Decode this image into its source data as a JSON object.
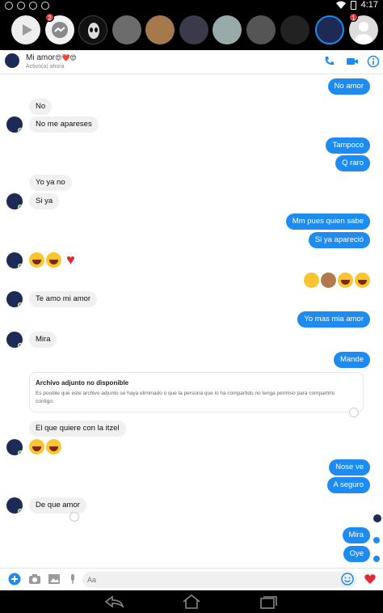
{
  "status_bar": {
    "time": "4:17"
  },
  "chat_heads": {
    "badge_messenger": "2",
    "badge_last": "1"
  },
  "header": {
    "name": "Mi amor",
    "name_emojis": "😍❤️😍",
    "status": "Activo(a) ahora"
  },
  "messages": [
    {
      "side": "out",
      "text": "No amor"
    },
    {
      "side": "in",
      "text": "No"
    },
    {
      "side": "in",
      "text": "No me apareses"
    },
    {
      "side": "out",
      "text": "Tampoco"
    },
    {
      "side": "out",
      "text": "Q raro"
    },
    {
      "side": "in",
      "text": "Yo ya no"
    },
    {
      "side": "in",
      "text": "Si ya"
    },
    {
      "side": "out",
      "text": "Mm pues quien sabe"
    },
    {
      "side": "out",
      "text": "Si ya apareció"
    },
    {
      "side": "in",
      "text": "Te amo mi amor"
    },
    {
      "side": "out",
      "text": "Yo mas mia amor"
    },
    {
      "side": "in",
      "text": "Mira"
    },
    {
      "side": "out",
      "text": "Mande"
    },
    {
      "side": "in",
      "text": "El que quiere con la itzel"
    },
    {
      "side": "out",
      "text": "Nose ve"
    },
    {
      "side": "out",
      "text": "A seguro"
    },
    {
      "side": "in",
      "text": "De que amor"
    },
    {
      "side": "out",
      "text": "Mira"
    },
    {
      "side": "out",
      "text": "Oye"
    }
  ],
  "attachment": {
    "title": "Archivo adjunto no disponible",
    "text": "Es posible que este archivo adjunto se haya eliminado o que la persona que lo ha compartido no tenga permiso para compartirlo contigo."
  },
  "composer": {
    "placeholder": "Aa"
  },
  "colors": {
    "accent": "#1e8bf0",
    "incoming": "#f1f0f0",
    "online": "#42b72a",
    "badge": "#e0393e"
  }
}
